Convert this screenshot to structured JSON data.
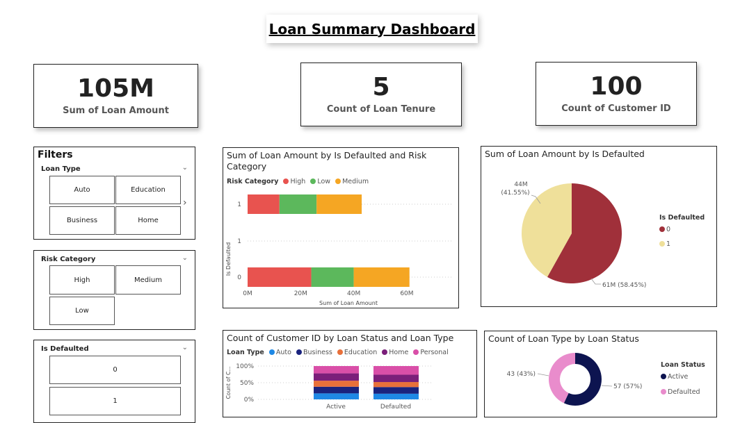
{
  "title": "Loan Summary Dashboard",
  "kpis": [
    {
      "value": "105M",
      "label": "Sum of Loan Amount"
    },
    {
      "value": "5",
      "label": "Count of Loan Tenure"
    },
    {
      "value": "100",
      "label": "Count of Customer ID"
    }
  ],
  "filters": {
    "heading": "Filters",
    "loan_type": {
      "label": "Loan Type",
      "options": [
        "Auto",
        "Education",
        "Business",
        "Home"
      ]
    },
    "risk_category": {
      "label": "Risk Category",
      "options": [
        "High",
        "Medium",
        "Low"
      ]
    },
    "is_defaulted": {
      "label": "Is Defaulted",
      "options": [
        "0",
        "1"
      ]
    }
  },
  "icons": {
    "chevron": "chevron-down-icon",
    "next": "chevron-right-icon"
  },
  "chart_data": [
    {
      "type": "bar",
      "orientation": "horizontal",
      "stacked": true,
      "title": "Sum of Loan Amount by Is Defaulted and Risk Category",
      "legend_title": "Risk Category",
      "categories": [
        "1",
        "0"
      ],
      "xlabel": "Sum of Loan Amount",
      "ylabel": "Is Defaulted",
      "xlim": [
        0,
        65
      ],
      "xticks": [
        "0M",
        "20M",
        "40M",
        "60M"
      ],
      "y_axis_labels": [
        "1",
        "1",
        "0"
      ],
      "series": [
        {
          "name": "High",
          "color": "#e8534f",
          "values": [
            12,
            24
          ]
        },
        {
          "name": "Low",
          "color": "#5cb85c",
          "values": [
            14,
            16
          ]
        },
        {
          "name": "Medium",
          "color": "#f5a623",
          "values": [
            17,
            21
          ]
        }
      ]
    },
    {
      "type": "pie",
      "title": "Sum of Loan Amount by Is Defaulted",
      "legend_title": "Is Defaulted",
      "slices": [
        {
          "name": "0",
          "value": 61,
          "percent": 58.45,
          "label": "61M (58.45%)",
          "color": "#a0303a"
        },
        {
          "name": "1",
          "value": 44,
          "percent": 41.55,
          "label_value": "44M",
          "label_pct": "(41.55%)",
          "color": "#efe09a"
        }
      ]
    },
    {
      "type": "bar",
      "orientation": "vertical",
      "stacked": true,
      "percent": true,
      "title": "Count of Customer ID by Loan Status and Loan Type",
      "legend_title": "Loan Type",
      "ylabel": "Count of C...",
      "categories": [
        "Active",
        "Defaulted"
      ],
      "yticks": [
        "100%",
        "50%",
        "0%"
      ],
      "series": [
        {
          "name": "Auto",
          "color": "#1e88e5",
          "values": [
            18,
            17
          ]
        },
        {
          "name": "Business",
          "color": "#1a237e",
          "values": [
            20,
            20
          ]
        },
        {
          "name": "Education",
          "color": "#e8703a",
          "values": [
            18,
            15
          ]
        },
        {
          "name": "Home",
          "color": "#7b1f7a",
          "values": [
            22,
            22
          ]
        },
        {
          "name": "Personal",
          "color": "#d94fa8",
          "values": [
            22,
            26
          ]
        }
      ]
    },
    {
      "type": "donut",
      "title": "Count of Loan Type by Loan Status",
      "legend_title": "Loan Status",
      "slices": [
        {
          "name": "Active",
          "value": 57,
          "percent": 57,
          "label": "57 (57%)",
          "color": "#0d1450"
        },
        {
          "name": "Defaulted",
          "value": 43,
          "percent": 43,
          "label": "43 (43%)",
          "color": "#e98ccc"
        }
      ]
    }
  ]
}
